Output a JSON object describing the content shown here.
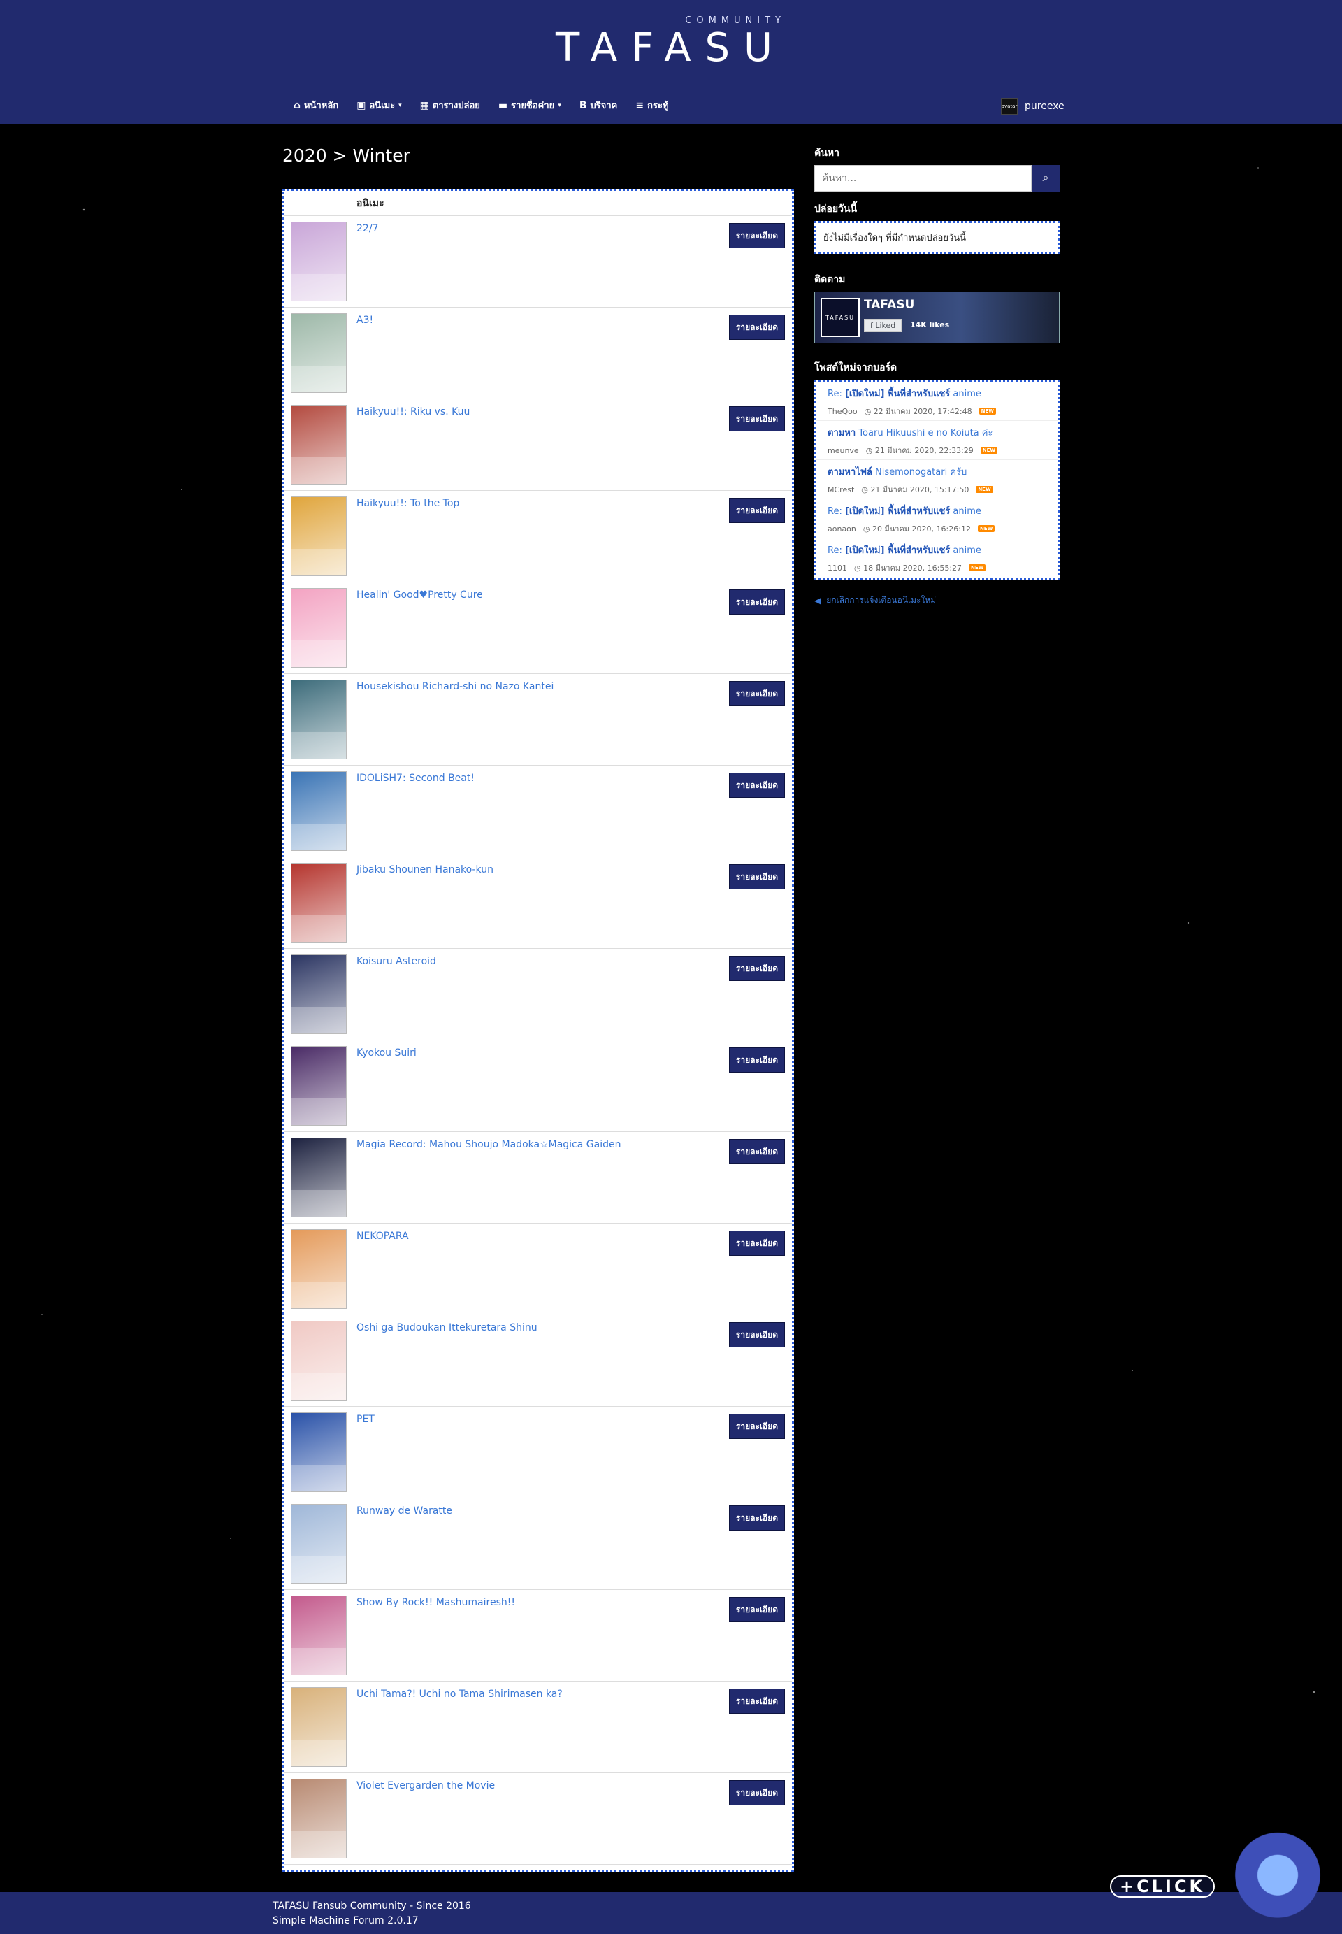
{
  "header": {
    "logo_sub": "COMMUNITY",
    "logo_main": "TAFASU",
    "nav": [
      {
        "icon": "home-icon",
        "glyph": "⌂",
        "label": "หน้าหลัก",
        "dropdown": false
      },
      {
        "icon": "film-icon",
        "glyph": "▣",
        "label": "อนิเมะ",
        "dropdown": true
      },
      {
        "icon": "calendar-icon",
        "glyph": "▦",
        "label": "ตารางปล่อย",
        "dropdown": false
      },
      {
        "icon": "folder-icon",
        "glyph": "▬",
        "label": "รายชื่อค่าย",
        "dropdown": true
      },
      {
        "icon": "bitcoin-icon",
        "glyph": "B",
        "label": "บริจาค",
        "dropdown": false
      },
      {
        "icon": "list-icon",
        "glyph": "≡",
        "label": "กระทู้",
        "dropdown": false
      }
    ],
    "user": {
      "name": "pureexe",
      "avatar_text": "avatar"
    }
  },
  "page_title": "2020 > Winter",
  "list": {
    "header": "อนิเมะ",
    "button_label": "รายละเอียด",
    "items": [
      {
        "title": "22/7",
        "color": "#c9a6d8"
      },
      {
        "title": "A3!",
        "color": "#9db8a8"
      },
      {
        "title": "Haikyuu!!: Riku vs. Kuu",
        "color": "#b34a3f"
      },
      {
        "title": "Haikyuu!!: To the Top",
        "color": "#e0a53c"
      },
      {
        "title": "Healin' Good♥Pretty Cure",
        "color": "#f3a3c2"
      },
      {
        "title": "Housekishou Richard-shi no Nazo Kantei",
        "color": "#3d6c7b"
      },
      {
        "title": "IDOLiSH7: Second Beat!",
        "color": "#3a74b5"
      },
      {
        "title": "Jibaku Shounen Hanako-kun",
        "color": "#b5352e"
      },
      {
        "title": "Koisuru Asteroid",
        "color": "#2b3562"
      },
      {
        "title": "Kyokou Suiri",
        "color": "#4a2b66"
      },
      {
        "title": "Magia Record: Mahou Shoujo Madoka☆Magica Gaiden",
        "color": "#1d2240"
      },
      {
        "title": "NEKOPARA",
        "color": "#e49a5a"
      },
      {
        "title": "Oshi ga Budoukan Ittekuretara Shinu",
        "color": "#f0c9c4"
      },
      {
        "title": "PET",
        "color": "#2a52a8"
      },
      {
        "title": "Runway de Waratte",
        "color": "#9fb7d8"
      },
      {
        "title": "Show By Rock!! Mashumairesh!!",
        "color": "#c35a8c"
      },
      {
        "title": "Uchi Tama?! Uchi no Tama Shirimasen ka?",
        "color": "#d8b17a"
      },
      {
        "title": "Violet Evergarden the Movie",
        "color": "#b88a72"
      }
    ]
  },
  "sidebar": {
    "search_heading": "ค้นหา",
    "search_placeholder": "ค้นหา...",
    "today_heading": "ปล่อยวันนี้",
    "today_text": "ยังไม่มีเรื่องใดๆ ที่มีกำหนดปล่อยวันนี้",
    "follow_heading": "ติดตาม",
    "fb": {
      "name": "TAFASU",
      "logo_text": "TAFASU",
      "like_label": "Liked",
      "likes": "14K likes"
    },
    "posts_heading": "โพสต์ใหม่จากบอร์ด",
    "posts": [
      {
        "prefix": "Re: ",
        "bold": "[เปิดใหม่] พื้นที่สำหรับแชร์",
        "rest": " anime",
        "author": "TheQoo",
        "date": "22 มีนาคม 2020, 17:42:48",
        "new": "NEW"
      },
      {
        "prefix": "",
        "bold": "ตามหา",
        "rest": " Toaru Hikuushi e no Koiuta ค่ะ",
        "author": "meunve",
        "date": "21 มีนาคม 2020, 22:33:29",
        "new": "NEW"
      },
      {
        "prefix": "",
        "bold": "ตามหาไฟล์",
        "rest": " Nisemonogatari ครับ",
        "author": "MCrest",
        "date": "21 มีนาคม 2020, 15:17:50",
        "new": "NEW"
      },
      {
        "prefix": "Re: ",
        "bold": "[เปิดใหม่] พื้นที่สำหรับแชร์",
        "rest": " anime",
        "author": "aonaon",
        "date": "20 มีนาคม 2020, 16:26:12",
        "new": "NEW"
      },
      {
        "prefix": "Re: ",
        "bold": "[เปิดใหม่] พื้นที่สำหรับแชร์",
        "rest": " anime",
        "author": "1101",
        "date": "18 มีนาคม 2020, 16:55:27",
        "new": "NEW"
      }
    ],
    "mark_link": "ยกเลิกการแจ้งเตือนอนิเมะใหม่"
  },
  "footer": {
    "line1": "TAFASU Fansub Community - Since 2016",
    "line2": "Simple Machine Forum 2.0.17"
  },
  "click_badge": "+CLICK"
}
